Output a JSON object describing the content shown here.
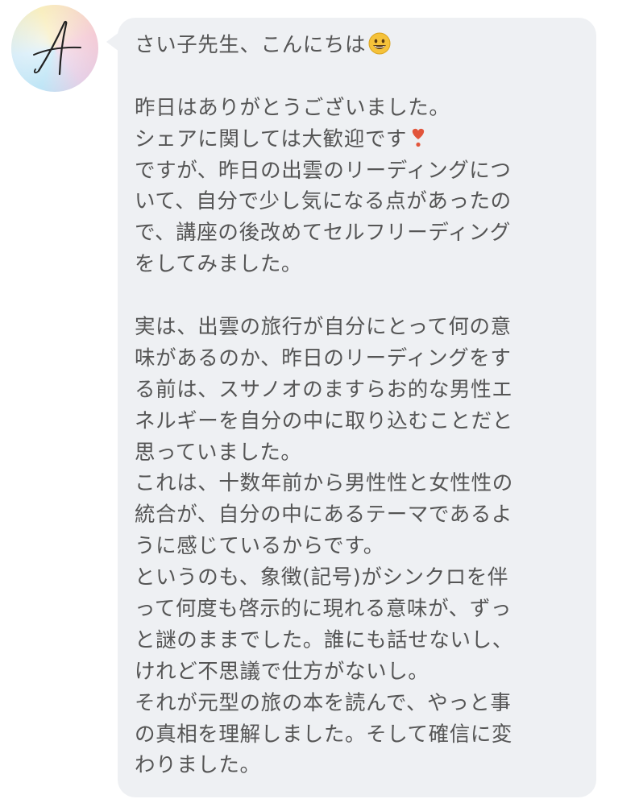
{
  "avatar": {
    "letter": "A",
    "colors": [
      "#b9e3f5",
      "#f6e8a8",
      "#f4c9d4",
      "#e6cfe6"
    ]
  },
  "message": {
    "lines": [
      "さい子先生、こんにちは",
      "",
      "昨日はありがとうございました。",
      "シェアに関しては大歓迎です",
      "ですが、昨日の出雲のリーディングにつ",
      "いて、自分で少し気になる点があったの",
      "で、講座の後改めてセルフリーディング",
      "をしてみました。",
      "",
      "実は、出雲の旅行が自分にとって何の意",
      "味があるのか、昨日のリーディングをす",
      "る前は、スサノオのますらお的な男性エ",
      "ネルギーを自分の中に取り込むことだと",
      "思っていました。",
      "これは、十数年前から男性性と女性性の",
      "統合が、自分の中にあるテーマであるよ",
      "うに感じているからです。",
      "というのも、象徴(記号)がシンクロを伴",
      "って何度も啓示的に現れる意味が、ずっ",
      "と謎のままでした。誰にも話せないし、",
      "けれど不思議で仕方がないし。",
      "それが元型の旅の本を読んで、やっと事",
      "の真相を理解しました。そして確信に変",
      "わりました。"
    ],
    "emojis": {
      "line_0": "grinning-face-emoji",
      "line_3": "heart-exclamation-emoji"
    },
    "bubble_color": "#eef0f3",
    "text_color": "#555555"
  }
}
